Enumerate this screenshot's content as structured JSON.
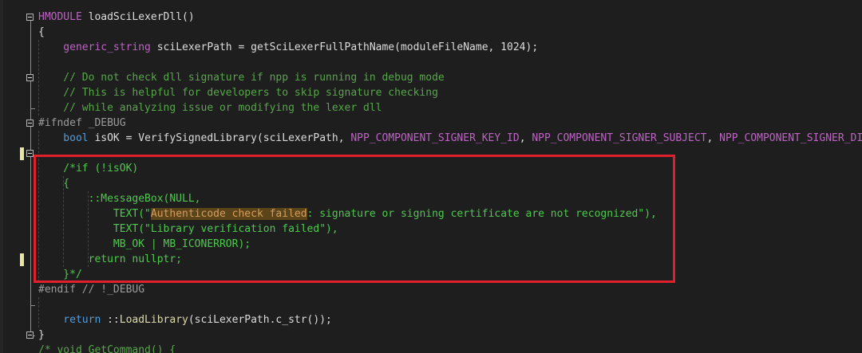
{
  "editor": {
    "colors": {
      "background": "#1e1e1e",
      "plain": "#dcdcdc",
      "keyword": "#569cd6",
      "macro": "#bd63c5",
      "preprocessor": "#9b9b9b",
      "comment": "#57a64a",
      "commented_code": "#4ec94e",
      "function": "#dcdcaa",
      "search_highlight": "#5a4418",
      "annotation_box": "#e0202a"
    },
    "fold_markers": [
      "line-1",
      "line-5",
      "line-8",
      "line-10",
      "line-22"
    ],
    "change_markers": [
      "line-10",
      "line-17"
    ],
    "lines": [
      [
        {
          "t": "HMODULE ",
          "c": "macro"
        },
        {
          "t": "loadSciLexerDll()",
          "c": "plain"
        }
      ],
      [
        {
          "t": "{",
          "c": "plain"
        }
      ],
      [
        {
          "t": "    generic_string ",
          "c": "macro"
        },
        {
          "t": "sciLexerPath = getSciLexerFullPathName(moduleFileName, 1024);",
          "c": "plain"
        }
      ],
      [],
      [
        {
          "t": "    // Do not check dll signature if npp is running in debug mode",
          "c": "comment"
        }
      ],
      [
        {
          "t": "    // This is helpful for developers to skip signature checking",
          "c": "comment"
        }
      ],
      [
        {
          "t": "    // while analyzing issue or modifying the lexer dll",
          "c": "comment"
        }
      ],
      [
        {
          "t": "#ifndef _DEBUG",
          "c": "pre"
        }
      ],
      [
        {
          "t": "    bool ",
          "c": "kw"
        },
        {
          "t": "isOK = VerifySignedLibrary(sciLexerPath, ",
          "c": "plain"
        },
        {
          "t": "NPP_COMPONENT_SIGNER_KEY_ID",
          "c": "macro"
        },
        {
          "t": ", ",
          "c": "plain"
        },
        {
          "t": "NPP_COMPONENT_SIGNER_SUBJECT",
          "c": "macro"
        },
        {
          "t": ", ",
          "c": "plain"
        },
        {
          "t": "NPP_COMPONENT_SIGNER_DISPLAY_",
          "c": "macro"
        }
      ],
      [],
      [
        {
          "t": "    /*if (!isOK)",
          "c": "green"
        }
      ],
      [
        {
          "t": "    {",
          "c": "green"
        }
      ],
      [
        {
          "t": "        ::MessageBox(NULL,",
          "c": "green"
        }
      ],
      [
        {
          "t": "            TEXT(\"",
          "c": "green"
        },
        {
          "t": "Authenticode check failed",
          "c": "hl"
        },
        {
          "t": ": signature or signing certificate are not recognized\"),",
          "c": "green"
        }
      ],
      [
        {
          "t": "            TEXT(\"Library verification failed\"),",
          "c": "green"
        }
      ],
      [
        {
          "t": "            MB_OK | MB_ICONERROR);",
          "c": "green"
        }
      ],
      [
        {
          "t": "        return nullptr;",
          "c": "green"
        }
      ],
      [
        {
          "t": "    }*/",
          "c": "green"
        }
      ],
      [
        {
          "t": "#endif // !_DEBUG",
          "c": "pre"
        }
      ],
      [],
      [
        {
          "t": "    return ",
          "c": "kw"
        },
        {
          "t": "::",
          "c": "plain"
        },
        {
          "t": "LoadLibrary",
          "c": "fn"
        },
        {
          "t": "(sciLexerPath.c_str());",
          "c": "plain"
        }
      ],
      [
        {
          "t": "}",
          "c": "plain"
        }
      ],
      [
        {
          "t": "/* void GetCommand() {",
          "c": "comment"
        }
      ]
    ]
  }
}
